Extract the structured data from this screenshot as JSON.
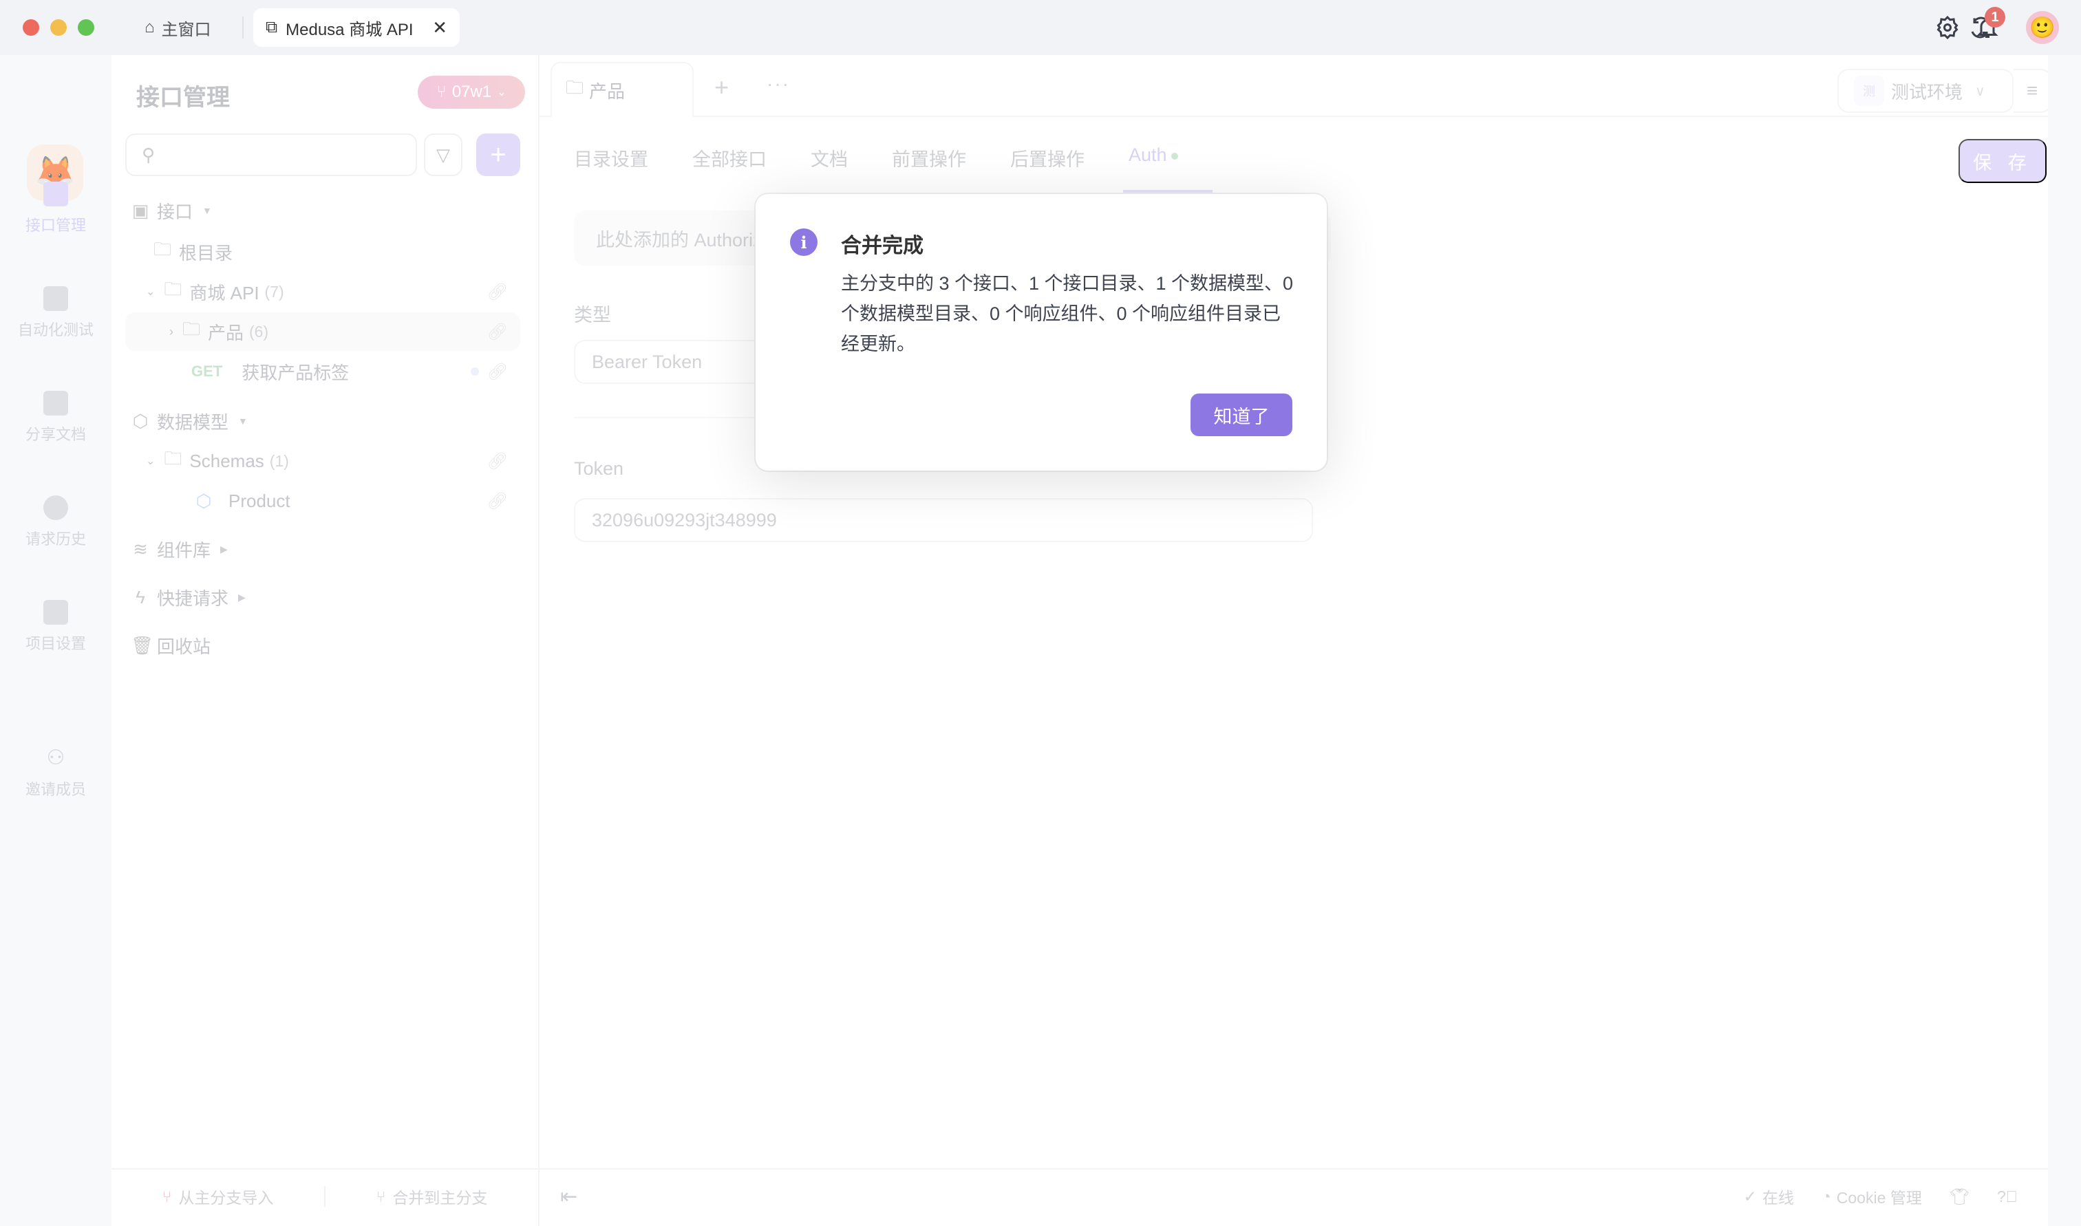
{
  "titlebar": {
    "home_tab": "主窗口",
    "active_tab": "Medusa 商城 API",
    "close_glyph": "✕",
    "notification_count": "1",
    "icons": [
      "refresh-icon",
      "settings-icon",
      "bell-icon",
      "avatar"
    ]
  },
  "rail": {
    "items": [
      {
        "label": "接口管理",
        "icon": "api-icon",
        "active": true
      },
      {
        "label": "自动化测试",
        "icon": "automation-icon"
      },
      {
        "label": "分享文档",
        "icon": "share-doc-icon"
      },
      {
        "label": "请求历史",
        "icon": "history-icon"
      },
      {
        "label": "项目设置",
        "icon": "project-settings-icon"
      },
      {
        "label": "邀请成员",
        "icon": "invite-user-icon"
      }
    ]
  },
  "sidebar": {
    "title": "接口管理",
    "branch": "07w1",
    "search_placeholder": "",
    "tree": {
      "api_section": "接口",
      "root": "根目录",
      "shop_api": {
        "label": "商城 API",
        "count": "(7)"
      },
      "product": {
        "label": "产品",
        "count": "(6)"
      },
      "endpoint": {
        "method": "GET",
        "label": "获取产品标签"
      },
      "models_section": "数据模型",
      "schemas": {
        "label": "Schemas",
        "count": "(1)"
      },
      "model_product": "Product",
      "components_section": "组件库",
      "quick_section": "快捷请求",
      "trash": "回收站"
    },
    "footer": {
      "import": "从主分支导入",
      "merge": "合并到主分支"
    }
  },
  "main": {
    "doc_tab": "产品",
    "env": {
      "badge": "测",
      "label": "测试环境"
    },
    "subtabs": [
      "目录设置",
      "全部接口",
      "文档",
      "前置操作",
      "后置操作",
      "Auth"
    ],
    "active_subtab": "Auth",
    "save": "保 存",
    "hint": "此处添加的 Authorization 将被该目录下的所有接口继承",
    "type_label": "类型",
    "type_value": "Bearer Token",
    "token_label": "Token",
    "token_value": "32096u09293jt348999",
    "footer": {
      "online": "在线",
      "cookie": "Cookie 管理"
    }
  },
  "modal": {
    "title": "合并完成",
    "body": "主分支中的 3 个接口、1 个接口目录、1 个数据模型、0 个数据模型目录、0 个响应组件、0 个响应组件目录已经更新。",
    "button": "知道了"
  },
  "colors": {
    "accent": "#8d77e3",
    "accent_light": "#e2dcfa",
    "badge_red": "#e4716b",
    "get_green": "#c8e6cf"
  }
}
